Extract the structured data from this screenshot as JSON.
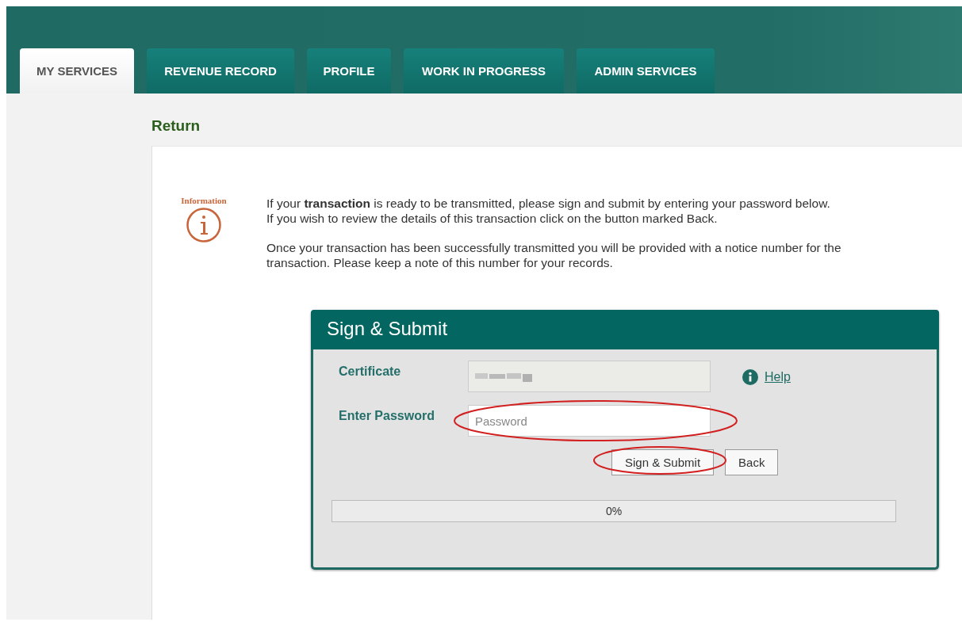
{
  "tabs": [
    {
      "label": "MY SERVICES",
      "selected": true
    },
    {
      "label": "REVENUE RECORD",
      "selected": false
    },
    {
      "label": "PROFILE",
      "selected": false
    },
    {
      "label": "WORK IN PROGRESS",
      "selected": false
    },
    {
      "label": "ADMIN SERVICES",
      "selected": false
    }
  ],
  "page_title": "Return",
  "information": {
    "label": "Information",
    "paragraphs": [
      "If your **transaction** is ready to be transmitted, please sign and submit by entering your password below.\nIf you wish to review the details of this transaction click on the button marked Back.",
      "Once your transaction has been successfully transmitted you will be provided with a notice number for the transaction. Please keep a note of this number for your records."
    ]
  },
  "sign_submit": {
    "title": "Sign & Submit",
    "certificate_label": "Certificate",
    "help_link": "Help",
    "password_label": "Enter Password",
    "password": {
      "placeholder": "Password"
    },
    "buttons": [
      "Sign & Submit",
      "Back"
    ],
    "progress": {
      "level": 0,
      "reading": "0%"
    }
  }
}
